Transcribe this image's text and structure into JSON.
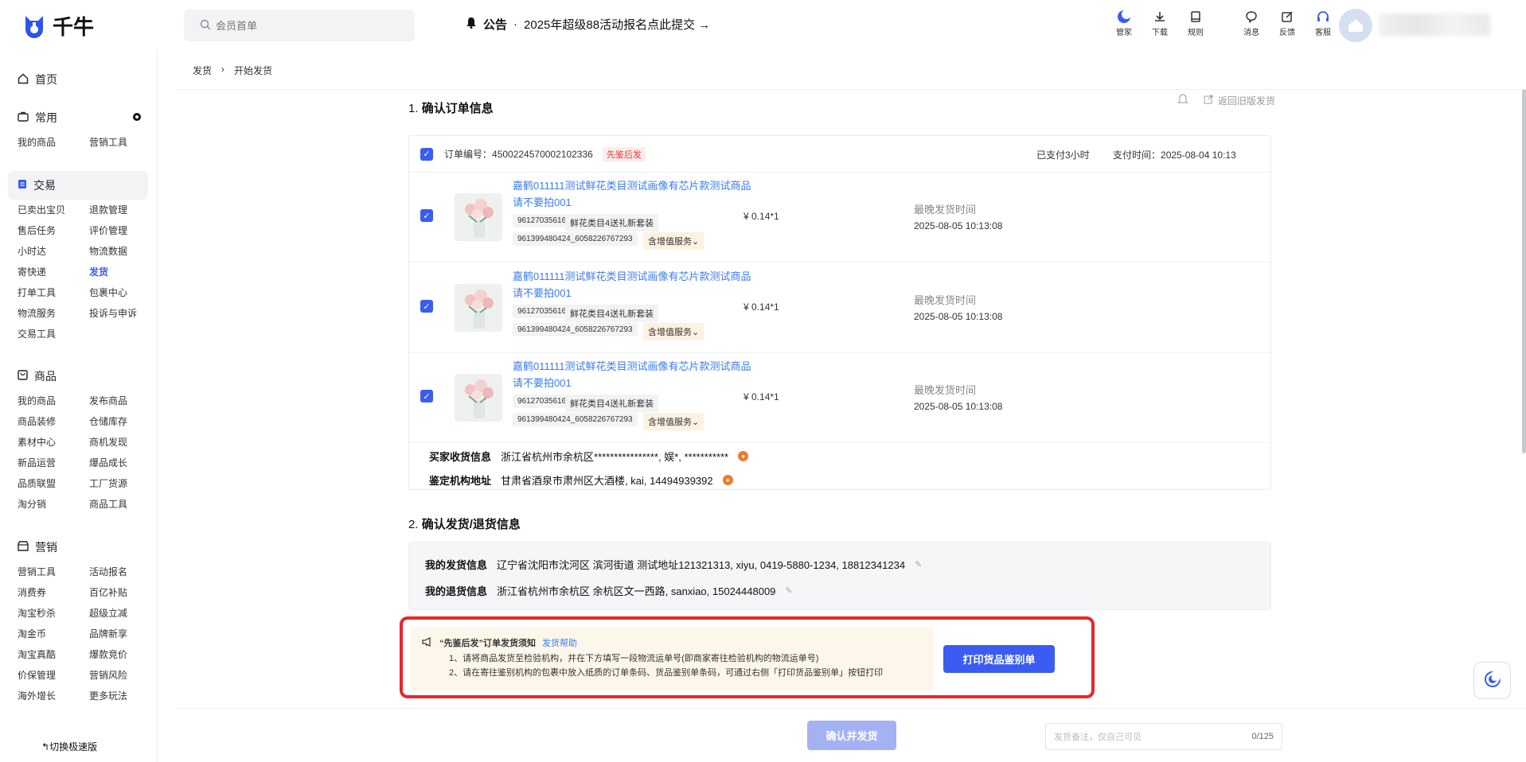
{
  "header": {
    "logo_text": "千牛",
    "search_placeholder": "会员首单",
    "notice_label": "公告",
    "notice_text": "2025年超级88活动报名点此提交 →",
    "icons": [
      {
        "label": "管家",
        "icon": "moon-icon"
      },
      {
        "label": "下载",
        "icon": "download-icon"
      },
      {
        "label": "规则",
        "icon": "book-icon"
      },
      {
        "label": "消息",
        "icon": "message-icon"
      },
      {
        "label": "反馈",
        "icon": "feedback-icon"
      },
      {
        "label": "客服",
        "icon": "headset-icon"
      }
    ]
  },
  "sidebar": {
    "home": "首页",
    "sections": [
      {
        "title": "常用",
        "items": [
          "我的商品",
          "营销工具"
        ]
      },
      {
        "title": "交易",
        "items": [
          "已卖出宝贝",
          "退款管理",
          "售后任务",
          "评价管理",
          "小时达",
          "物流数据",
          "寄快递",
          "发货",
          "打单工具",
          "包裹中心",
          "物流服务",
          "投诉与申诉",
          "交易工具"
        ]
      },
      {
        "title": "商品",
        "items": [
          "我的商品",
          "发布商品",
          "商品装修",
          "仓储库存",
          "素材中心",
          "商机发现",
          "新品运营",
          "爆品成长",
          "品质联盟",
          "工厂货源",
          "淘分销",
          "商品工具"
        ]
      },
      {
        "title": "营销",
        "items": [
          "营销工具",
          "活动报名",
          "消费券",
          "百亿补贴",
          "淘宝秒杀",
          "超级立减",
          "淘金币",
          "品牌新享",
          "淘宝真酷",
          "爆款竞价",
          "价保管理",
          "营销风险",
          "海外增长",
          "更多玩法"
        ]
      }
    ],
    "active_item": "发货",
    "switch_label": "切换极速版"
  },
  "breadcrumb": {
    "parent": "发货",
    "sep": "›",
    "current": "开始发货"
  },
  "section1": {
    "num": "1.",
    "title": "确认订单信息",
    "old_version": "返回旧版发货"
  },
  "order": {
    "number_label": "订单编号：",
    "number": "4500224570002102336",
    "badge": "先鉴后发",
    "paid": "已支付3小时",
    "pay_time_label": "支付时间：",
    "pay_time": "2025-08-04 10:13",
    "items": [
      {
        "title": "嘉鹤011111测试鲜花类目测试画像有芯片款测试商品请不要拍001",
        "tag1": "961270356165",
        "tag2": "鲜花类目4送礼新套装",
        "tag3": "961399480424_6058226767293",
        "service": "含增值服务⌄",
        "price": "¥ 0.14*1",
        "deadline_label": "最晚发货时间",
        "deadline": "2025-08-05 10:13:08"
      },
      {
        "title": "嘉鹤011111测试鲜花类目测试画像有芯片款测试商品请不要拍001",
        "tag1": "961270356165",
        "tag2": "鲜花类目4送礼新套装",
        "tag3": "961399480424_6058226767293",
        "service": "含增值服务⌄",
        "price": "¥ 0.14*1",
        "deadline_label": "最晚发货时间",
        "deadline": "2025-08-05 10:13:08"
      },
      {
        "title": "嘉鹤011111测试鲜花类目测试画像有芯片款测试商品请不要拍001",
        "tag1": "961270356165",
        "tag2": "鲜花类目4送礼新套装",
        "tag3": "961399480424_6058226767293",
        "service": "含增值服务⌄",
        "price": "¥ 0.14*1",
        "deadline_label": "最晚发货时间",
        "deadline": "2025-08-05 10:13:08"
      }
    ],
    "buyer_label": "买家收货信息",
    "buyer": "浙江省杭州市余杭区****************, 娱*, ***********",
    "org_label": "鉴定机构地址",
    "org": "甘肃省酒泉市肃州区大酒楼, kai, 14494939392"
  },
  "section2": {
    "num": "2.",
    "title": "确认发货/退货信息"
  },
  "shipping": {
    "send_label": "我的发货信息",
    "send": "辽宁省沈阳市沈河区 滨河街道 测试地址121321313, xiyu, 0419-5880-1234, 18812341234",
    "return_label": "我的退货信息",
    "return": "浙江省杭州市余杭区 余杭区文一西路, sanxiao, 15024448009"
  },
  "tips": {
    "title": "“先鉴后发”订单发货须知",
    "help": "发货帮助",
    "line1": "1、请将商品发货至检验机构，并在下方填写一段物流运单号(即商家寄往检验机构的物流运单号)",
    "line2": "2、请在寄往鉴别机构的包裹中放入纸质的订单条码、货品鉴别单条码，可通过右侧「打印货品鉴别单」按钮打印"
  },
  "print_button": "打印货品鉴别单",
  "footer": {
    "confirm": "确认并发货",
    "remark_placeholder": "发货备注，仅自己可见",
    "remark_count": "0/125"
  },
  "colors": {
    "accent": "#3b5cf2",
    "link": "#3b7cf2",
    "highlight_border": "#e8262b",
    "tips_bg": "#fdf6ea"
  }
}
